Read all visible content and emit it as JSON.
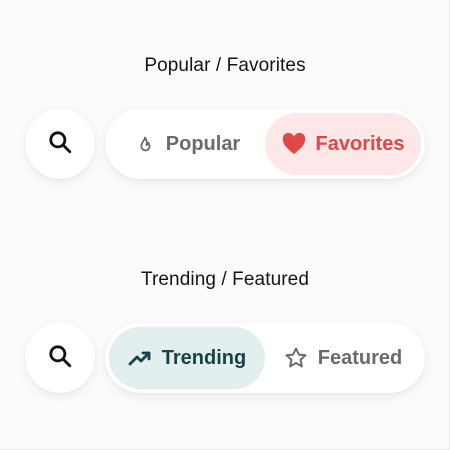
{
  "sections": [
    {
      "title": "Popular / Favorites",
      "search_icon": "search-icon",
      "segments": [
        {
          "label": "Popular",
          "icon": "flame-icon",
          "selected": false
        },
        {
          "label": "Favorites",
          "icon": "heart-icon",
          "selected": true
        }
      ]
    },
    {
      "title": "Trending / Featured",
      "search_icon": "search-icon",
      "segments": [
        {
          "label": "Trending",
          "icon": "trending-up-icon",
          "selected": true
        },
        {
          "label": "Featured",
          "icon": "star-icon",
          "selected": false
        }
      ]
    }
  ],
  "colors": {
    "favorites_text": "#e04747",
    "favorites_bg": "#fde7e7",
    "trending_text": "#18424a",
    "trending_bg": "#e3eeee",
    "inactive_text": "#6b6b6b"
  }
}
